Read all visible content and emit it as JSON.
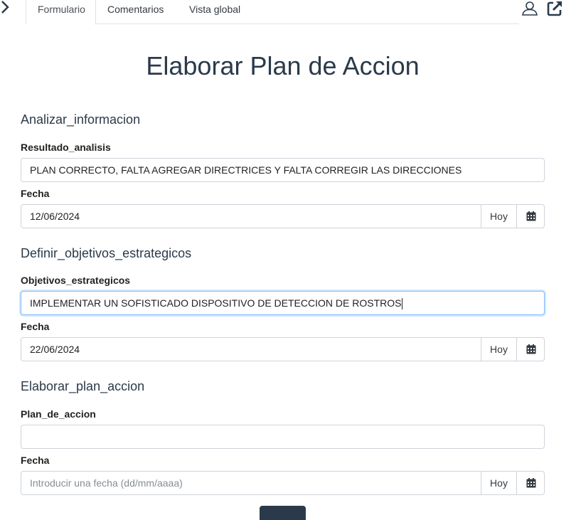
{
  "tabs": [
    {
      "label": "Formulario",
      "active": true
    },
    {
      "label": "Comentarios",
      "active": false
    },
    {
      "label": "Vista global",
      "active": false
    }
  ],
  "header": {
    "title": "Elaborar Plan de Accion"
  },
  "sections": [
    {
      "title": "Analizar_informacion",
      "text_label": "Resultado_analisis",
      "text_value": "PLAN CORRECTO, FALTA AGREGAR DIRECTRICES Y FALTA CORREGIR LAS DIRECCIONES",
      "date_label": "Fecha",
      "date_value": "12/06/2024",
      "today_label": "Hoy"
    },
    {
      "title": "Definir_objetivos_estrategicos",
      "text_label": "Objetivos_estrategicos",
      "text_value": "IMPLEMENTAR UN SOFISTICADO DISPOSITIVO DE DETECCION DE ROSTROS",
      "date_label": "Fecha",
      "date_value": "22/06/2024",
      "today_label": "Hoy"
    },
    {
      "title": "Elaborar_plan_accion",
      "text_label": "Plan_de_accion",
      "text_value": "",
      "date_label": "Fecha",
      "date_value": "",
      "date_placeholder": "Introducir una fecha (dd/mm/aaaa)",
      "today_label": "Hoy"
    }
  ],
  "icons": {
    "back": "chevron-right-icon",
    "user": "user-icon",
    "external": "external-link-icon",
    "calendar": "calendar-icon"
  },
  "colors": {
    "heading": "#2b3a4a",
    "border": "#ced4da",
    "focus": "#80bdff"
  }
}
